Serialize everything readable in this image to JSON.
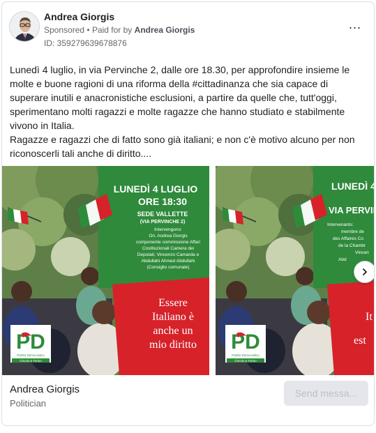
{
  "header": {
    "advertiser_name": "Andrea Giorgis",
    "sponsored_label": "Sponsored",
    "separator": "•",
    "paid_for_prefix": "Paid for by",
    "paid_for_name": "Andrea Giorgis",
    "ad_id": "ID: 359279639678876",
    "more_menu": "..."
  },
  "body_text": "Lunedì 4 luglio, in via Pervinche 2, dalle ore 18.30, per approfondire insieme le molte e buone ragioni di una riforma della #cittadinanza che sia capace di superare inutili e anacronistiche esclusioni, a partire da quelle che, tutt'oggi, sperimentano molti ragazzi e molte ragazze che hanno studiato e stabilmente vivono in Italia.\nRagazze e ragazzi che di fatto sono già italiani; e non c'è motivo alcuno per non riconoscerli tali anche di diritto....",
  "carousel": {
    "slide_1": {
      "date": "LUNEDÌ 4 LUGLIO",
      "time": "ORE 18:30",
      "venue": "SEDE VALLETTE",
      "venue_detail": "(VIA PERVINCHE 2)",
      "speakers": [
        "Intervengono:",
        "On. Andrea Giorgis",
        "componente commissione Affari",
        "Costituzionali Camera dei",
        "Deputati, Vincenzo Camarda e",
        "Abdullahi Ahmed Abdullahi",
        "(Consiglio comunale)"
      ],
      "slogan": [
        "Essere",
        "Italiano è",
        "anche un",
        "mio diritto"
      ],
      "logo_letters": "PD",
      "logo_party": "Partito Democratico",
      "logo_circle": "Circolo 5 Torino"
    },
    "slide_2": {
      "date": "LUNEDÌ 4",
      "venue": "VIA PERVIN",
      "speakers": [
        "Intervenants:",
        "membre de",
        "des Affaires Co",
        "de la Chambr",
        "Vincen",
        "Abd"
      ],
      "slogan": [
        "It",
        "est"
      ],
      "logo_letters": "PD",
      "logo_party": "Partito Democratico",
      "logo_circle": "Circolo 5 Torino"
    },
    "next_icon": "chevron-right-icon"
  },
  "footer": {
    "page_name": "Andrea Giorgis",
    "category": "Politician",
    "cta_label": "Send messa..."
  },
  "colors": {
    "pd_green": "#2e8b3a",
    "pd_red": "#d7222a",
    "poster_green": "#2f8a3b",
    "cta_bg": "#e4e6eb"
  }
}
